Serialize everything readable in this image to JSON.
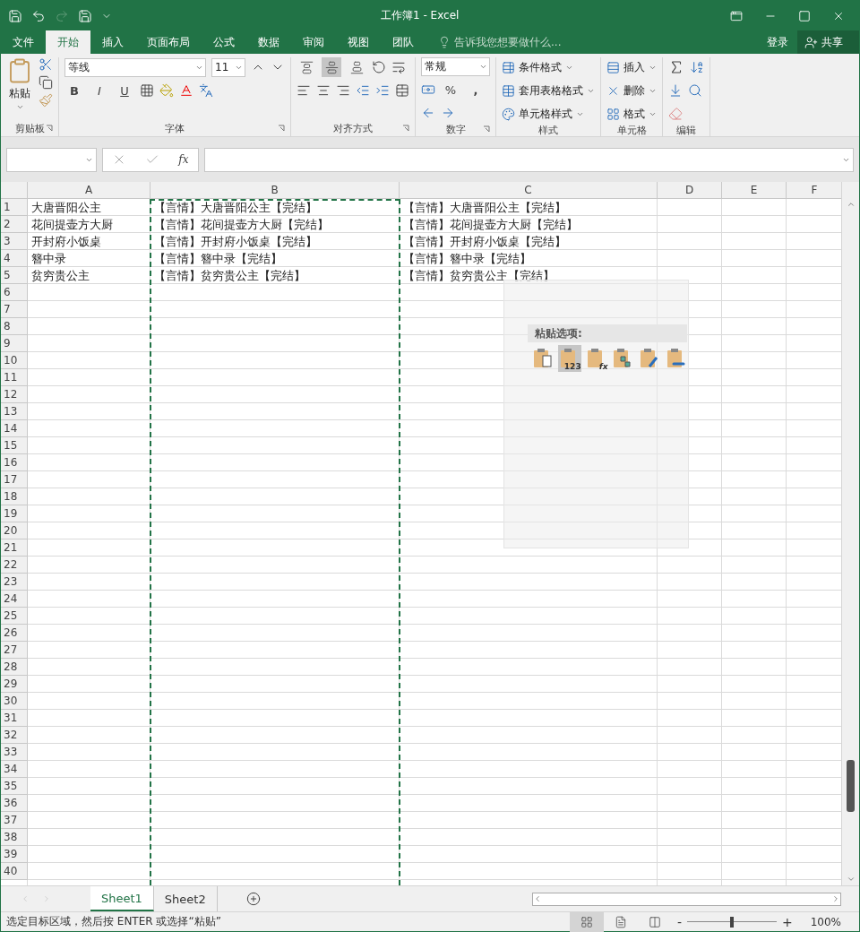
{
  "window": {
    "title": "工作簿1 - Excel",
    "redo_disabled": true
  },
  "menu_tabs": [
    {
      "label": "文件",
      "selected": false
    },
    {
      "label": "开始",
      "selected": true
    },
    {
      "label": "插入",
      "selected": false
    },
    {
      "label": "页面布局",
      "selected": false
    },
    {
      "label": "公式",
      "selected": false
    },
    {
      "label": "数据",
      "selected": false
    },
    {
      "label": "审阅",
      "selected": false
    },
    {
      "label": "视图",
      "selected": false
    },
    {
      "label": "团队",
      "selected": false
    }
  ],
  "tell_me": {
    "placeholder": "告诉我您想要做什么..."
  },
  "sign_in": "登录",
  "share": "共享",
  "ribbon": {
    "clipboard": {
      "label": "剪贴板",
      "paste": "粘贴"
    },
    "font": {
      "label": "字体",
      "name": "等线",
      "size": "11",
      "bold": "B",
      "italic": "I",
      "underline": "U"
    },
    "alignment": {
      "label": "对齐方式",
      "vertical": [
        {
          "selected": false
        },
        {
          "selected": true
        },
        {
          "selected": false
        }
      ]
    },
    "number": {
      "label": "数字",
      "format": "常规",
      "percent": "%",
      "comma": ","
    },
    "styles": {
      "label": "样式",
      "items": [
        "条件格式",
        "套用表格格式",
        "单元格样式"
      ]
    },
    "cells": {
      "label": "单元格",
      "items": [
        "插入",
        "删除",
        "格式"
      ]
    },
    "editing": {
      "label": "编辑"
    }
  },
  "formula_bar": {
    "fx": "fx"
  },
  "sheet": {
    "columns": [
      {
        "label": "A",
        "copied": false
      },
      {
        "label": "B",
        "copied": true
      },
      {
        "label": "C",
        "copied": false
      },
      {
        "label": "D",
        "copied": false
      },
      {
        "label": "E",
        "copied": false
      },
      {
        "label": "F",
        "copied": false
      }
    ],
    "rows": [
      {
        "number": "1",
        "cells": [
          "大唐晋阳公主",
          "【言情】大唐晋阳公主【完结】",
          "【言情】大唐晋阳公主【完结】"
        ]
      },
      {
        "number": "2",
        "cells": [
          "花间提壶方大厨",
          "【言情】花间提壶方大厨【完结】",
          "【言情】花间提壶方大厨【完结】"
        ]
      },
      {
        "number": "3",
        "cells": [
          "开封府小饭桌",
          "【言情】开封府小饭桌【完结】",
          "【言情】开封府小饭桌【完结】"
        ]
      },
      {
        "number": "4",
        "cells": [
          "簪中录",
          "【言情】簪中录【完结】",
          "【言情】簪中录【完结】"
        ]
      },
      {
        "number": "5",
        "cells": [
          "贫穷贵公主",
          "【言情】贫穷贵公主【完结】",
          "【言情】贫穷贵公主【完结】"
        ]
      },
      {
        "number": "6"
      },
      {
        "number": "7"
      },
      {
        "number": "8"
      },
      {
        "number": "9"
      },
      {
        "number": "10"
      },
      {
        "number": "11"
      },
      {
        "number": "12"
      },
      {
        "number": "13"
      },
      {
        "number": "14"
      },
      {
        "number": "15"
      },
      {
        "number": "16"
      },
      {
        "number": "17"
      },
      {
        "number": "18"
      },
      {
        "number": "19"
      },
      {
        "number": "20"
      },
      {
        "number": "21"
      },
      {
        "number": "22"
      },
      {
        "number": "23"
      },
      {
        "number": "24"
      },
      {
        "number": "25"
      },
      {
        "number": "26"
      },
      {
        "number": "27"
      },
      {
        "number": "28"
      },
      {
        "number": "29"
      },
      {
        "number": "30"
      },
      {
        "number": "31"
      },
      {
        "number": "32"
      },
      {
        "number": "33"
      },
      {
        "number": "34"
      },
      {
        "number": "35"
      },
      {
        "number": "36"
      },
      {
        "number": "37"
      },
      {
        "number": "38"
      },
      {
        "number": "39"
      },
      {
        "number": "40"
      }
    ]
  },
  "paste_options": {
    "title": "粘贴选项:",
    "items": [
      {
        "kind": "paste",
        "selected": false
      },
      {
        "kind": "values",
        "overlay": "123",
        "selected": true
      },
      {
        "kind": "formulas",
        "overlay": "fx",
        "selected": false
      },
      {
        "kind": "transpose",
        "selected": false
      },
      {
        "kind": "formatting",
        "selected": false
      },
      {
        "kind": "link",
        "selected": false
      }
    ]
  },
  "sheet_tabs": [
    {
      "label": "Sheet1",
      "selected": true
    },
    {
      "label": "Sheet2",
      "selected": false
    }
  ],
  "status_bar": {
    "message": "选定目标区域，然后按 ENTER 或选择“粘贴”",
    "views": [
      {
        "kind": "normal",
        "selected": true
      },
      {
        "kind": "layout",
        "selected": false
      },
      {
        "kind": "break",
        "selected": false
      }
    ],
    "zoom_out": "-",
    "zoom_in": "+",
    "zoom": {
      "level": 0.5
    },
    "zoom_text": "100%"
  }
}
